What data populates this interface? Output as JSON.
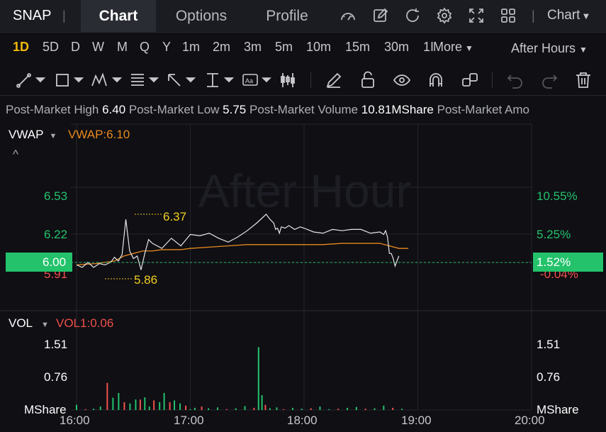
{
  "ticker": "SNAP",
  "tabs": [
    "Chart",
    "Options",
    "Profile"
  ],
  "chart_type_label": "Chart",
  "intervals": [
    "1D",
    "5D",
    "D",
    "W",
    "M",
    "Q",
    "Y",
    "1m",
    "2m",
    "3m",
    "5m",
    "10m",
    "15m",
    "30m",
    "1I"
  ],
  "more_label": "More",
  "session_label": "After Hours",
  "stats": {
    "high_label": "Post-Market High",
    "high": "6.40",
    "low_label": "Post-Market Low",
    "low": "5.75",
    "vol_label": "Post-Market Volume",
    "vol": "10.81MShare",
    "amount_label": "Post-Market Amo"
  },
  "price_panel": {
    "indicator": "VWAP",
    "indicator_value": "VWAP:6.10",
    "watermark": "After Hour",
    "left_ticks": [
      "6.53",
      "6.22",
      "5.91"
    ],
    "right_ticks": [
      "10.55%",
      "5.25%",
      "-0.04%"
    ],
    "current_price": "6.00",
    "current_pct": "1.52%",
    "high_annotation": "6.37",
    "low_annotation": "5.86"
  },
  "vol_panel": {
    "indicator": "VOL",
    "indicator_value": "VOL1:0.06",
    "left_ticks": [
      "1.51",
      "0.76",
      "MShare"
    ],
    "right_ticks": [
      "1.51",
      "0.76",
      "MShare"
    ]
  },
  "time_axis": [
    "16:00",
    "17:00",
    "18:00",
    "19:00",
    "20:00"
  ],
  "colors": {
    "accent": "#f0b90b",
    "up": "#23c26b",
    "down": "#f0504a",
    "vwap": "#e8891d",
    "price_line": "#e6e6e6"
  },
  "chart_data": {
    "type": "line",
    "title": "",
    "xlabel": "",
    "ylabel": "",
    "x_range": [
      "16:00",
      "20:00"
    ],
    "ylim": [
      5.86,
      6.6
    ],
    "series": [
      {
        "name": "",
        "x": [
          0,
          3,
          6,
          9,
          12,
          15,
          18,
          20,
          22,
          24,
          26,
          28,
          30,
          32,
          34,
          36,
          38,
          40,
          45,
          50,
          55,
          60,
          65,
          70,
          75,
          80,
          85,
          90,
          95,
          100,
          102,
          104,
          105,
          106,
          107,
          108,
          110,
          112,
          115,
          118,
          120,
          125,
          130,
          135,
          140,
          145,
          150,
          155,
          160,
          162,
          163,
          164,
          165,
          166,
          167,
          168,
          170
        ],
        "y": [
          5.97,
          5.95,
          5.99,
          5.95,
          5.98,
          5.97,
          5.99,
          6.03,
          6.0,
          6.05,
          6.33,
          6.08,
          6.02,
          6.04,
          5.93,
          6.06,
          6.17,
          6.14,
          6.1,
          6.18,
          6.12,
          6.21,
          6.2,
          6.22,
          6.18,
          6.15,
          6.19,
          6.24,
          6.3,
          6.37,
          6.33,
          6.3,
          6.25,
          6.26,
          6.22,
          6.27,
          6.26,
          6.28,
          6.25,
          6.27,
          6.26,
          6.23,
          6.22,
          6.25,
          6.24,
          6.25,
          6.25,
          6.22,
          6.23,
          6.21,
          6.24,
          6.19,
          6.06,
          6.06,
          6.02,
          5.96,
          6.04
        ]
      },
      {
        "name": "VWAP",
        "x": [
          0,
          10,
          20,
          25,
          30,
          35,
          40,
          45,
          50,
          55,
          60,
          70,
          80,
          90,
          100,
          110,
          120,
          130,
          140,
          150,
          160,
          170,
          175,
          180,
          190,
          200,
          210,
          220,
          230,
          240
        ],
        "y": [
          5.97,
          5.98,
          6.0,
          6.04,
          6.06,
          6.08,
          6.08,
          6.09,
          6.09,
          6.09,
          6.1,
          6.11,
          6.12,
          6.13,
          6.13,
          6.13,
          6.13,
          6.13,
          6.14,
          6.14,
          6.14,
          6.1,
          6.1,
          6.1,
          6.1,
          6.1,
          6.1,
          6.1,
          6.1,
          6.1
        ]
      },
      {
        "name": "VOL1",
        "x": [
          0,
          8,
          15,
          21,
          27,
          32,
          37,
          42,
          47,
          52,
          56,
          60,
          64,
          68,
          73,
          77,
          82,
          86,
          91,
          96,
          100,
          104,
          110,
          116,
          124,
          132,
          140,
          148,
          156,
          160,
          163,
          166,
          170,
          176,
          182,
          190,
          198,
          206,
          214,
          222,
          230,
          238,
          246,
          254,
          262,
          270,
          278,
          286
        ],
        "y": [
          0.12,
          0.02,
          0.03,
          0.08,
          0.62,
          0.28,
          0.39,
          0.18,
          0.15,
          0.24,
          0.24,
          0.29,
          0.08,
          0.22,
          0.18,
          0.39,
          0.18,
          0.22,
          0.15,
          0.1,
          0.02,
          0.05,
          0.08,
          0.04,
          0.06,
          0.02,
          0.04,
          0.09,
          0.05,
          1.44,
          0.34,
          0.12,
          0.04,
          0.06,
          0.02,
          0.05,
          0.03,
          0.04,
          0.08,
          0.02,
          0.03,
          0.05,
          0.07,
          0.03,
          0.04,
          0.1,
          0.05,
          0.03
        ]
      }
    ]
  }
}
